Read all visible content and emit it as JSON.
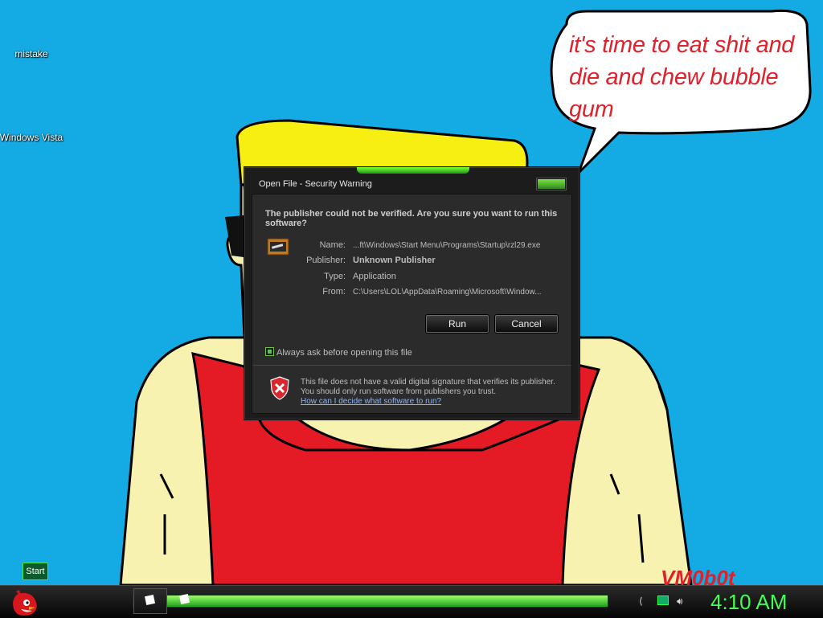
{
  "desktop": {
    "icons": [
      {
        "label": "mistake"
      },
      {
        "label": "Windows Vista"
      }
    ],
    "speech_bubble": "it's time to eat shit and die and chew bubble gum",
    "signature": "VM0b0t"
  },
  "dialog": {
    "title": "Open File - Security Warning",
    "heading": "The publisher could not be verified.  Are you sure you want to run this software?",
    "fields": [
      {
        "label": "Name:",
        "value": "...ft\\Windows\\Start Menu\\Programs\\Startup\\rzl29.exe"
      },
      {
        "label": "Publisher:",
        "value": "Unknown Publisher"
      },
      {
        "label": "Type:",
        "value": "Application"
      },
      {
        "label": "From:",
        "value": "C:\\Users\\LOL\\AppData\\Roaming\\Microsoft\\Window..."
      }
    ],
    "run_label": "Run",
    "cancel_label": "Cancel",
    "checkbox_label": "Always ask before opening this file",
    "checkbox_checked": true,
    "warning_text": "This file does not have a valid digital signature that verifies its publisher.  You should only run software from publishers you trust.",
    "help_link": "How can I decide what software to run?"
  },
  "taskbar": {
    "start_label": "Start",
    "clock": "4:10 AM",
    "accent": "#40ff50"
  }
}
